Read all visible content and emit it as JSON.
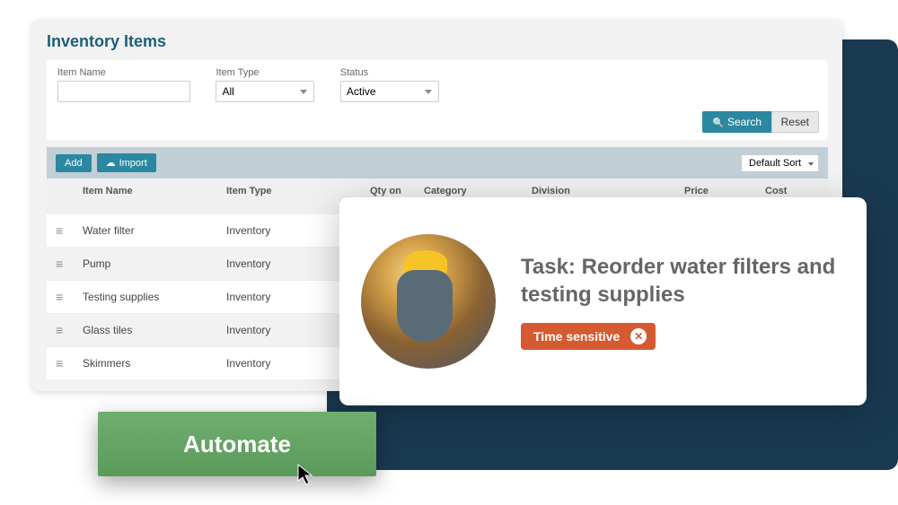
{
  "page_title": "Inventory Items",
  "filters": {
    "item_name": {
      "label": "Item Name",
      "value": ""
    },
    "item_type": {
      "label": "Item Type",
      "value": "All"
    },
    "status": {
      "label": "Status",
      "value": "Active"
    }
  },
  "buttons": {
    "search": "Search",
    "reset": "Reset",
    "add": "Add",
    "import": "Import",
    "automate": "Automate"
  },
  "sort": {
    "value": "Default Sort"
  },
  "columns": [
    "Item Name",
    "Item Type",
    "Qty on Hand",
    "Category",
    "Division",
    "Price",
    "Cost"
  ],
  "rows": [
    {
      "name": "Water filter",
      "type": "Inventory"
    },
    {
      "name": "Pump",
      "type": "Inventory"
    },
    {
      "name": "Testing supplies",
      "type": "Inventory"
    },
    {
      "name": "Glass tiles",
      "type": "Inventory"
    },
    {
      "name": "Skimmers",
      "type": "Inventory"
    }
  ],
  "task": {
    "title": "Task: Reorder water filters and testing supplies",
    "badge": "Time sensitive"
  }
}
